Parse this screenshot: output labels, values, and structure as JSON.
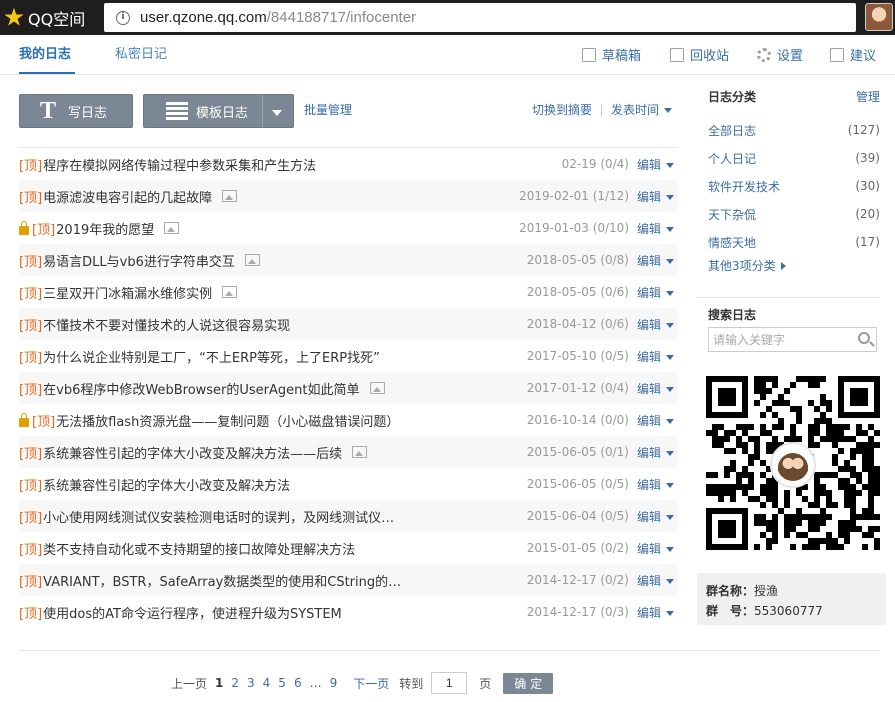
{
  "browser": {
    "brand": "QQ空间",
    "url_host": "user.qzone.qq.com",
    "url_path": "/844188717/infocenter"
  },
  "tabs": {
    "active": "我的日志",
    "private": "私密日记"
  },
  "toolbar": {
    "drafts": "草稿箱",
    "recycle": "回收站",
    "settings": "设置",
    "suggest": "建议"
  },
  "actions": {
    "write": "写日志",
    "template": "模板日志",
    "batch": "批量管理",
    "switch_summary": "切换到摘要",
    "sort_time": "发表时间"
  },
  "list": {
    "top_tag": "[顶]",
    "edit_label": "编辑",
    "rows": [
      {
        "title": "程序在模拟网络传输过程中参数采集和产生方法",
        "date": "02-19",
        "count": "(0/4)",
        "locked": false,
        "image": false
      },
      {
        "title": "电源滤波电容引起的几起故障",
        "date": "2019-02-01",
        "count": "(1/12)",
        "locked": false,
        "image": true
      },
      {
        "title": "2019年我的愿望",
        "date": "2019-01-03",
        "count": "(0/10)",
        "locked": true,
        "image": true
      },
      {
        "title": "易语言DLL与vb6进行字符串交互",
        "date": "2018-05-05",
        "count": "(0/8)",
        "locked": false,
        "image": true
      },
      {
        "title": "三星双开门冰箱漏水维修实例",
        "date": "2018-05-05",
        "count": "(0/6)",
        "locked": false,
        "image": true
      },
      {
        "title": "不懂技术不要对懂技术的人说这很容易实现",
        "date": "2018-04-12",
        "count": "(0/6)",
        "locked": false,
        "image": false
      },
      {
        "title": "为什么说企业特别是工厂，“不上ERP等死，上了ERP找死”",
        "date": "2017-05-10",
        "count": "(0/5)",
        "locked": false,
        "image": false
      },
      {
        "title": "在vb6程序中修改WebBrowser的UserAgent如此简单",
        "date": "2017-01-12",
        "count": "(0/4)",
        "locked": false,
        "image": true
      },
      {
        "title": "无法播放flash资源光盘——复制问题（小心磁盘错误问题）",
        "date": "2016-10-14",
        "count": "(0/0)",
        "locked": true,
        "image": false
      },
      {
        "title": "系统兼容性引起的字体大小改变及解决方法——后续",
        "date": "2015-06-05",
        "count": "(0/1)",
        "locked": false,
        "image": true
      },
      {
        "title": "系统兼容性引起的字体大小改变及解决方法",
        "date": "2015-06-05",
        "count": "(0/5)",
        "locked": false,
        "image": false
      },
      {
        "title": "小心使用网线测试仪安装检测电话时的误判，及网线测试仪…",
        "date": "2015-06-04",
        "count": "(0/5)",
        "locked": false,
        "image": false
      },
      {
        "title": "类不支持自动化或不支持期望的接口故障处理解决方法",
        "date": "2015-01-05",
        "count": "(0/2)",
        "locked": false,
        "image": false
      },
      {
        "title": "VARIANT，BSTR，SafeArray数据类型的使用和CString的…",
        "date": "2014-12-17",
        "count": "(0/2)",
        "locked": false,
        "image": false
      },
      {
        "title": "使用dos的AT命令运行程序，使进程升级为SYSTEM",
        "date": "2014-12-17",
        "count": "(0/3)",
        "locked": false,
        "image": false
      }
    ]
  },
  "pager": {
    "prev": "上一页",
    "pages": [
      "1",
      "2",
      "3",
      "4",
      "5",
      "6"
    ],
    "current": "1",
    "ellipsis": "…",
    "last": "9",
    "next": "下一页",
    "goto": "转到",
    "input_value": "1",
    "page_unit": "页",
    "confirm": "确 定"
  },
  "sidebar": {
    "title": "日志分类",
    "manage": "管理",
    "categories": [
      {
        "name": "全部日志",
        "count": "(127)"
      },
      {
        "name": "个人日记",
        "count": "(39)"
      },
      {
        "name": "软件开发技术",
        "count": "(30)"
      },
      {
        "name": "天下杂侃",
        "count": "(20)"
      },
      {
        "name": "情感天地",
        "count": "(17)"
      }
    ],
    "more": "其他3项分类",
    "search_title": "搜索日志",
    "search_placeholder": "请输入关键字",
    "group_name_label": "群名称：",
    "group_name": "授渔",
    "group_no_label": "群　号：",
    "group_no": "553060777"
  }
}
